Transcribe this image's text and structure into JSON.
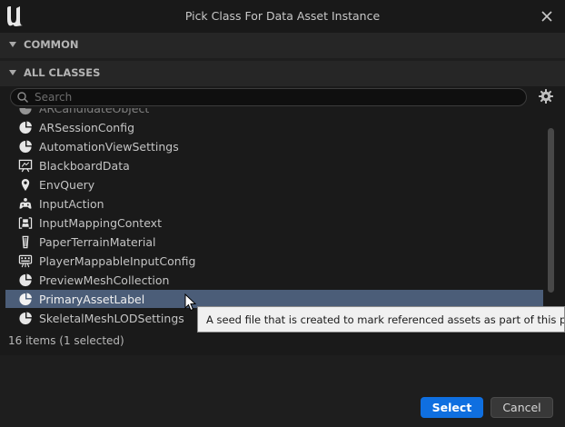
{
  "dialog": {
    "title": "Pick Class For Data Asset Instance"
  },
  "sections": {
    "common": "COMMON",
    "all_classes": "ALL CLASSES"
  },
  "search": {
    "placeholder": "Search"
  },
  "class_list": [
    {
      "label": "ARCandidateObject",
      "icon": "class-icon"
    },
    {
      "label": "ARSessionConfig",
      "icon": "class-icon"
    },
    {
      "label": "AutomationViewSettings",
      "icon": "class-icon"
    },
    {
      "label": "BlackboardData",
      "icon": "blackboard-icon"
    },
    {
      "label": "EnvQuery",
      "icon": "location-pin-icon"
    },
    {
      "label": "InputAction",
      "icon": "gamepad-icon"
    },
    {
      "label": "InputMappingContext",
      "icon": "input-mapping-icon"
    },
    {
      "label": "PaperTerrainMaterial",
      "icon": "paper-terrain-icon"
    },
    {
      "label": "PlayerMappableInputConfig",
      "icon": "keyboard-icon"
    },
    {
      "label": "PreviewMeshCollection",
      "icon": "class-icon"
    },
    {
      "label": "PrimaryAssetLabel",
      "icon": "class-icon",
      "selected": true
    },
    {
      "label": "SkeletalMeshLODSettings",
      "icon": "class-icon"
    }
  ],
  "tooltip": "A seed file that is created to mark referenced assets as part of this primary",
  "status": "16 items (1 selected)",
  "buttons": {
    "select": "Select",
    "cancel": "Cancel"
  },
  "colors": {
    "selection": "#4b5d78",
    "primary_button": "#0f6fe0",
    "background": "#1e1e1e"
  }
}
